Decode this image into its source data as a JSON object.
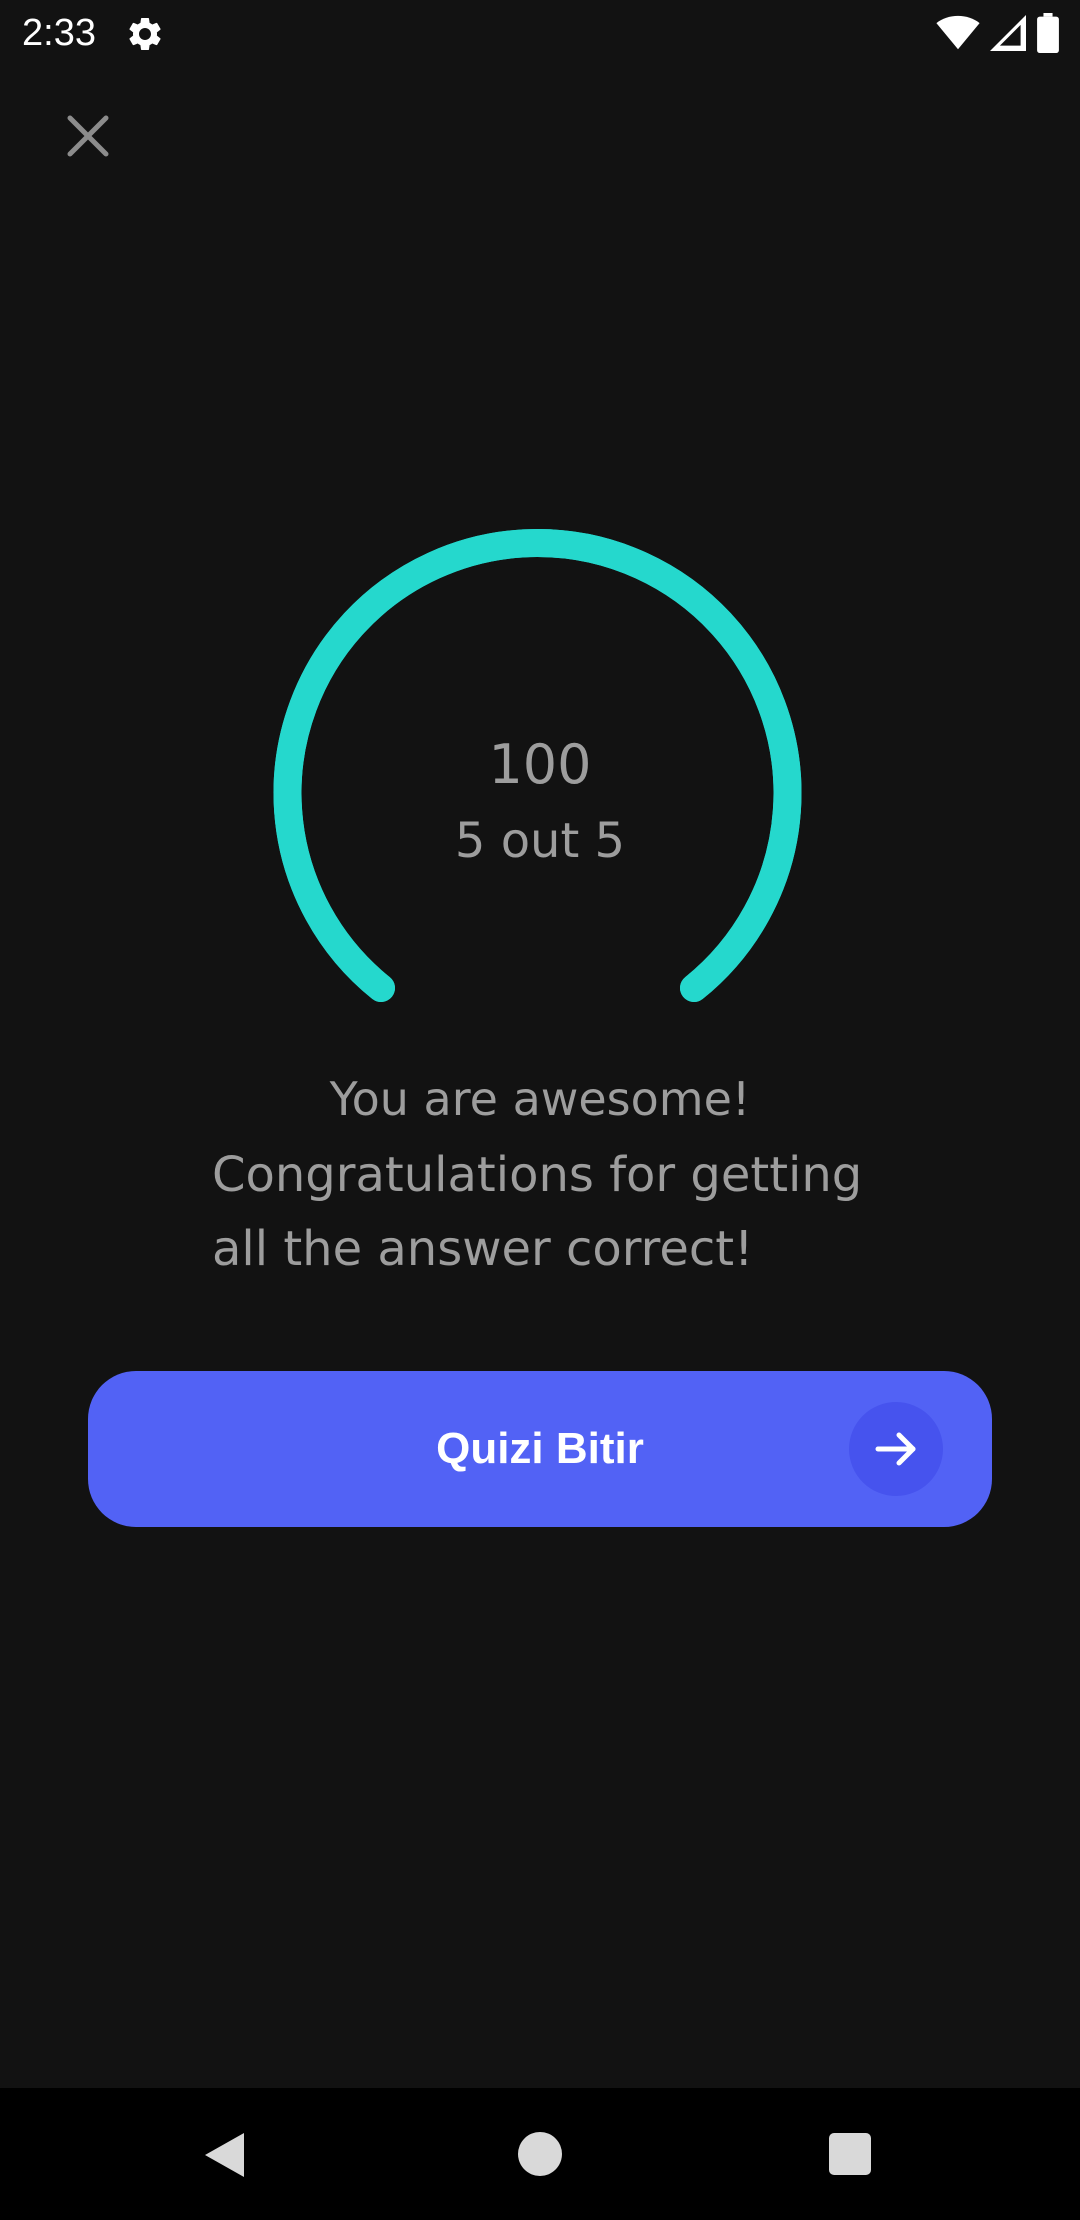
{
  "status_bar": {
    "time": "2:33",
    "icons": [
      "settings-icon",
      "wifi-icon",
      "cellular-signal-icon",
      "battery-icon"
    ]
  },
  "header": {
    "close_icon": "close-icon"
  },
  "result": {
    "score": "100",
    "detail": "5 out 5",
    "progress_fraction": 1.0,
    "gauge_color": "#25d8cd"
  },
  "message": {
    "title": "You are awesome!",
    "line1": "Congratulations for getting",
    "line2": "all the answer correct!"
  },
  "finish_button": {
    "label": "Quizi Bitir",
    "icon": "arrow-right-icon",
    "color": "#5262f5"
  },
  "nav_bar": {
    "icons": [
      "back-icon",
      "home-icon",
      "recents-icon"
    ]
  },
  "colors": {
    "background": "#121212",
    "text": "#9d9d9d"
  }
}
